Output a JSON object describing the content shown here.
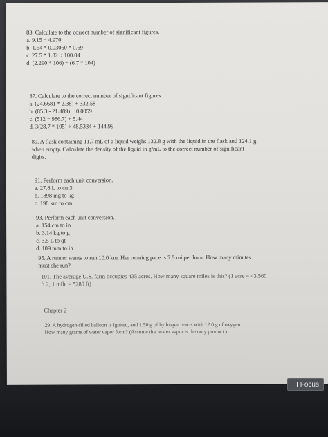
{
  "q83": {
    "title": "83. Calculate to the correct number of significant figures.",
    "a": "a. 9.15 ÷ 4.970",
    "b": "b. 1.54 * 0.03060 * 0.69",
    "c": "c. 27.5 * 1.82 ÷ 100.04",
    "d": "d. (2.290 * 106) ÷ (6.7 * 104)"
  },
  "q87": {
    "title": "87. Calculate to the correct number of significant figures.",
    "a": "a. (24.6681 * 2.38) + 332.58",
    "b": "b. (85.3 - 21.489) ÷ 0.0059",
    "c": "c. (512 ÷ 986.7) + 5.44",
    "d": "d. 3(28.7 * 105) ÷ 48.5334 + 144.99"
  },
  "q89": {
    "line1": "89. A flask containing 11.7 mL of a liquid weighs 132.8 g with the liquid in the flask and 124.1 g",
    "line2": "when empty. Calculate the density of the liquid in g/mL to the correct number of significant",
    "line3": "digits."
  },
  "q91": {
    "title": "91. Perform each unit conversion.",
    "a": "a. 27.8 L to cm3",
    "b": "b. 1898 mg to kg",
    "c": "c. 198 km to cm"
  },
  "q93": {
    "title": "93. Perform each unit conversion.",
    "a": "a. 154 cm to in",
    "b": "b. 3.14 kg to g",
    "c": "c. 3.5 L to qt",
    "d": "d. 109 mm to in"
  },
  "q95": {
    "line1": "95. A runner wants to run 10.0 km. Her running pace is 7.5 mi per hour. How many minutes",
    "line2": "must she run?"
  },
  "q101": {
    "line1": "101. The average U.S. farm occupies 435 acres. How many square miles is this? (1 acre = 43,560",
    "line2": "ft 2, 1 mile = 5280 ft)"
  },
  "chapter": "Chapter 2",
  "q29": {
    "line1": "29. A hydrogen-filled balloon is ignited, and 1.50 g of hydrogen reacts with 12.0 g of oxygen.",
    "line2": "How many grams of water vapor form? (Assume that water vapor is the only product.)"
  },
  "focus_button": "Focus"
}
